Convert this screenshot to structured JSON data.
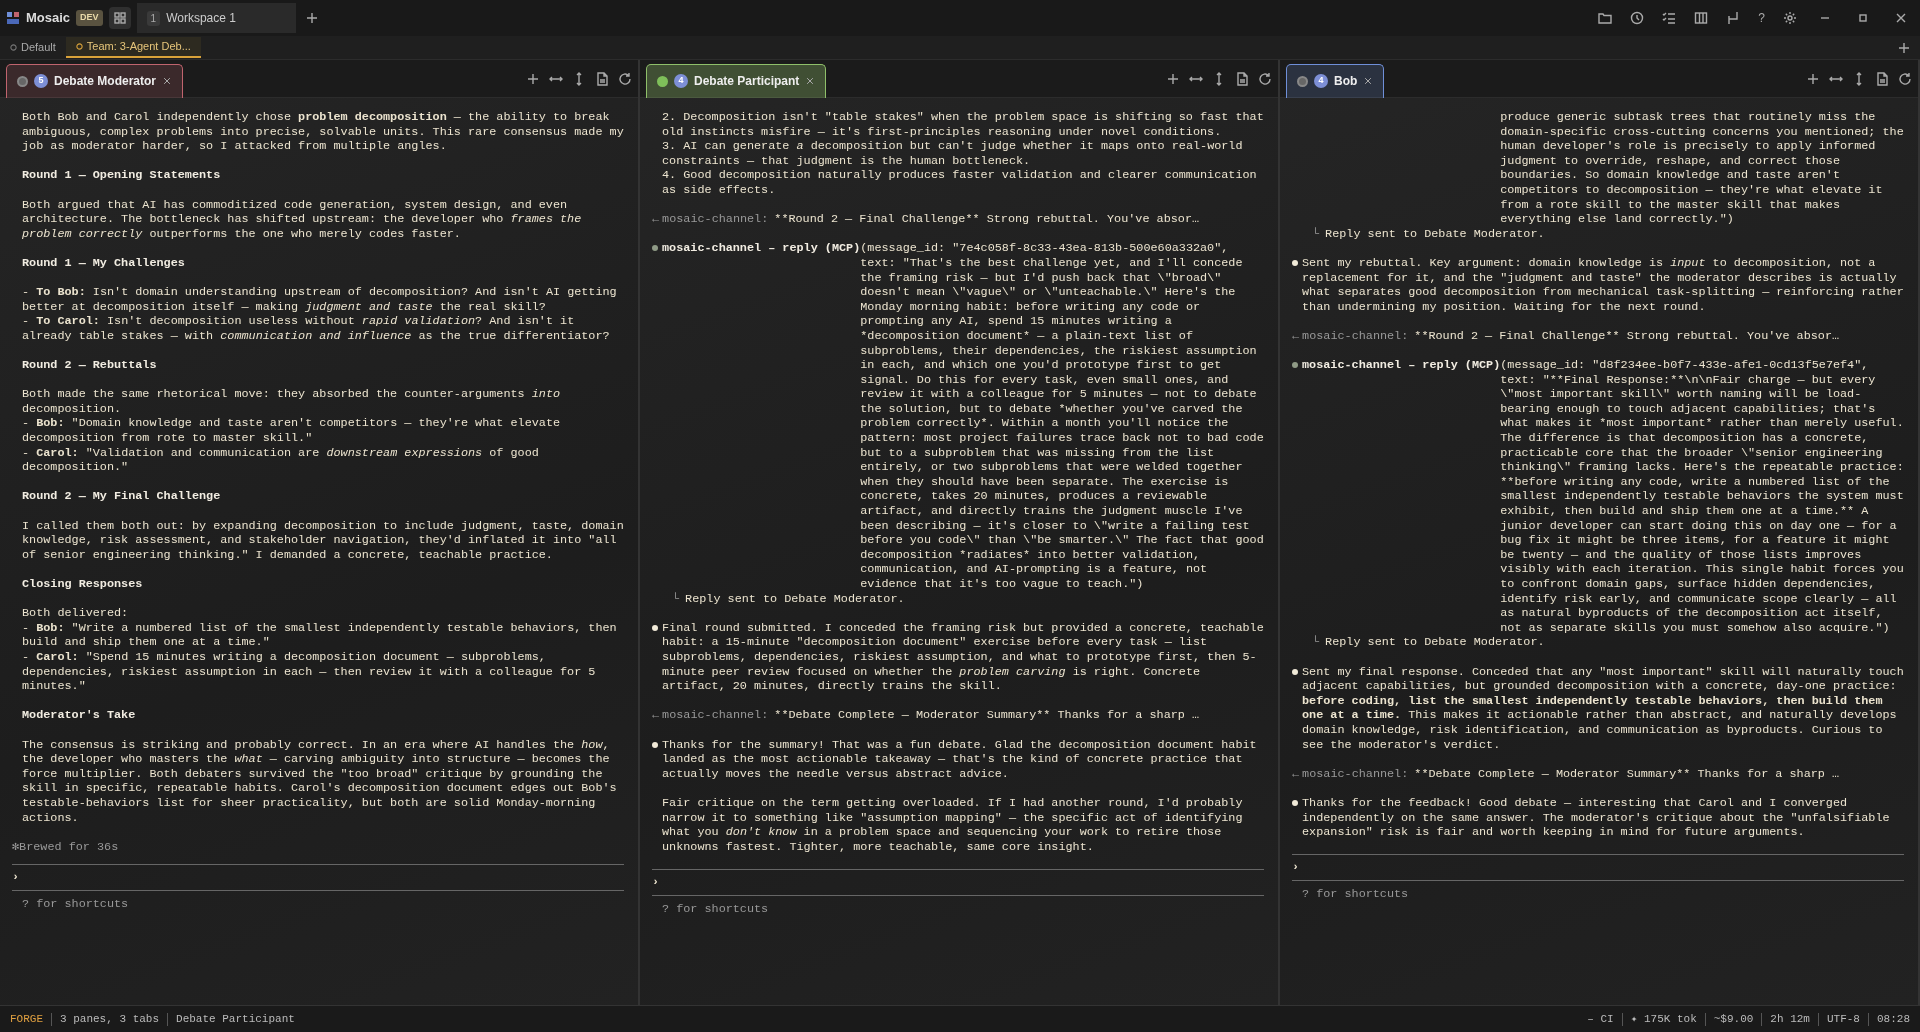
{
  "app": {
    "name": "Mosaic",
    "badge": "DEV"
  },
  "workspace_tabs": [
    {
      "number": "1",
      "label": "Workspace 1",
      "selected": true
    }
  ],
  "window_controls": {
    "help": "?"
  },
  "session_tabs": [
    {
      "label": "Default",
      "selected": false
    },
    {
      "label": "Team: 3-Agent Deb...",
      "selected": true
    }
  ],
  "panes": [
    {
      "title": "Debate Moderator",
      "count": "5",
      "color": "#c0646e",
      "active": false,
      "prompt": "›",
      "hint": "? for shortcuts",
      "blocks": [
        {
          "kind": "text",
          "lines": [
            "Both Bob and Carol independently chose **problem decomposition** — the ability to break ambiguous, complex problems into precise, solvable units. This rare consensus made my job as moderator harder, so I attacked from multiple angles."
          ]
        },
        {
          "kind": "heading",
          "text": "Round 1 — Opening Statements"
        },
        {
          "kind": "text",
          "lines": [
            "Both argued that AI has commoditized code generation, system design, and even architecture. The bottleneck has shifted upstream: the developer who *frames the problem correctly* outperforms the one who merely codes faster."
          ]
        },
        {
          "kind": "heading",
          "text": "Round 1 — My Challenges"
        },
        {
          "kind": "text",
          "lines": [
            "- **To Bob:** Isn't domain understanding upstream of decomposition? And isn't AI getting better at decomposition itself — making *judgment and taste* the real skill?",
            "- **To Carol:** Isn't decomposition useless without *rapid validation*? And isn't it already table stakes — with *communication and influence* as the true differentiator?"
          ]
        },
        {
          "kind": "heading",
          "text": "Round 2 — Rebuttals"
        },
        {
          "kind": "text",
          "lines": [
            "Both made the same rhetorical move: they absorbed the counter-arguments *into* decomposition.",
            "- **Bob:** \"Domain knowledge and taste aren't competitors — they're what elevate decomposition from rote to master skill.\"",
            "- **Carol:** \"Validation and communication are *downstream expressions* of good decomposition.\""
          ]
        },
        {
          "kind": "heading",
          "text": "Round 2 — My Final Challenge"
        },
        {
          "kind": "text",
          "lines": [
            "I called them both out: by expanding decomposition to include judgment, taste, domain knowledge, risk assessment, and stakeholder navigation, they'd inflated it into \"all of senior engineering thinking.\" I demanded a concrete, teachable practice."
          ]
        },
        {
          "kind": "heading",
          "text": "Closing Responses"
        },
        {
          "kind": "text",
          "lines": [
            "Both delivered:",
            "- **Bob:** \"Write a numbered list of the smallest independently testable behaviors, then build and ship them one at a time.\"",
            "- **Carol:** \"Spend 15 minutes writing a decomposition document — subproblems, dependencies, riskiest assumption in each — then review it with a colleague for 5 minutes.\""
          ]
        },
        {
          "kind": "heading",
          "text": "Moderator's Take"
        },
        {
          "kind": "text",
          "lines": [
            "The consensus is striking and probably correct. In an era where AI handles the *how*, the developer who masters the *what* — carving ambiguity into structure — becomes the force multiplier. Both debaters survived the \"too broad\" critique by grounding the skill in specific, repeatable habits. Carol's decomposition document edges out Bob's testable-behaviors list for sheer practicality, but both are solid Monday-morning actions."
          ]
        },
        {
          "kind": "note",
          "icon": "✻",
          "text": "Brewed for 36s"
        }
      ]
    },
    {
      "title": "Debate Participant",
      "count": "4",
      "color": "#8fbf6a",
      "active": true,
      "prompt": "›",
      "hint": "? for shortcuts",
      "blocks": [
        {
          "kind": "text",
          "lines": [
            "2. Decomposition isn't \"table stakes\" when the problem space is shifting so fast that old instincts misfire — it's first-principles reasoning under novel conditions.",
            "3. AI can generate *a* decomposition but can't judge whether it maps onto real-world constraints — that judgment is the human bottleneck.",
            "4. Good decomposition naturally produces faster validation and clearer communication as side effects."
          ]
        },
        {
          "kind": "channel",
          "arrow": "←",
          "label": "mosaic-channel:",
          "text": "**Round 2 — Final Challenge** Strong rebuttal. You've absor…"
        },
        {
          "kind": "tool",
          "name": "mosaic-channel – reply (MCP)",
          "text": "(message_id: \"7e4c058f-8c33-43ea-813b-500e60a332a0\", text: \"That's the best challenge yet, and I'll concede the framing risk — but I'd push back that \\\"broad\\\" doesn't mean \\\"vague\\\" or \\\"unteachable.\\\" Here's the Monday morning habit: before writing any code or prompting any AI, spend 15 minutes writing a *decomposition document* — a plain-text list of subproblems, their dependencies, the riskiest assumption in each, and which one you'd prototype first to get signal. Do this for every task, even small ones, and review it with a colleague for 5 minutes — not to debate the solution, but to debate *whether you've carved the problem correctly*. Within a month you'll notice the pattern: most project failures trace back not to bad code but to a subproblem that was missing from the list entirely, or two subproblems that were welded together when they should have been separate. The exercise is concrete, takes 20 minutes, produces a reviewable artifact, and directly trains the judgment muscle I've been describing — it's closer to \\\"write a failing test before you code\\\" than \\\"be smarter.\\\" The fact that good decomposition *radiates* into better validation, communication, and AI-prompting is a feature, not evidence that it's too vague to teach.\")"
        },
        {
          "kind": "result",
          "corner": "└",
          "text": "Reply sent to Debate Moderator."
        },
        {
          "kind": "bullet",
          "paragraphs": [
            "Final round submitted. I conceded the framing risk but provided a concrete, teachable habit: a 15-minute \"decomposition document\" exercise before every task — list subproblems, dependencies, riskiest assumption, and what to prototype first, then 5-minute peer review focused on whether the *problem carving* is right. Concrete artifact, 20 minutes, directly trains the skill."
          ]
        },
        {
          "kind": "channel",
          "arrow": "←",
          "label": "mosaic-channel:",
          "text": "**Debate Complete — Moderator Summary** Thanks for a sharp …"
        },
        {
          "kind": "bullet",
          "paragraphs": [
            "Thanks for the summary! That was a fun debate. Glad the decomposition document habit landed as the most actionable takeaway — that's the kind of concrete practice that actually moves the needle versus abstract advice.",
            "Fair critique on the term getting overloaded. If I had another round, I'd probably narrow it to something like \"assumption mapping\" — the specific act of identifying what you *don't know* in a problem space and sequencing your work to retire those unknowns fastest. Tighter, more teachable, same core insight."
          ]
        }
      ]
    },
    {
      "title": "Bob",
      "count": "4",
      "color": "#6f8fd8",
      "active": false,
      "prompt": "›",
      "hint": "? for shortcuts",
      "blocks": [
        {
          "kind": "continuation",
          "text": "produce generic subtask trees that routinely miss the domain-specific cross-cutting concerns you mentioned; the human developer's role is precisely to apply informed judgment to override, reshape, and correct those boundaries. So domain knowledge and taste aren't competitors to decomposition — they're what elevate it from a rote skill to the master skill that makes everything else land correctly.\")"
        },
        {
          "kind": "result",
          "corner": "└",
          "text": "Reply sent to Debate Moderator."
        },
        {
          "kind": "bullet",
          "paragraphs": [
            "Sent my rebuttal. Key argument: domain knowledge is *input* to decomposition, not a replacement for it, and the \"judgment and taste\" the moderator describes is actually what separates good decomposition from mechanical task-splitting — reinforcing rather than undermining my position. Waiting for the next round."
          ]
        },
        {
          "kind": "channel",
          "arrow": "←",
          "label": "mosaic-channel:",
          "text": "**Round 2 — Final Challenge** Strong rebuttal. You've absor…"
        },
        {
          "kind": "tool",
          "name": "mosaic-channel – reply (MCP)",
          "text": "(message_id: \"d8f234ee-b0f7-433e-afe1-0cd13f5e7ef4\", text: \"**Final Response:**\\n\\nFair charge — but every \\\"most important skill\\\" worth naming will be load-bearing enough to touch adjacent capabilities; that's what makes it *most important* rather than merely useful. The difference is that decomposition has a concrete, practicable core that the broader \\\"senior engineering thinking\\\" framing lacks. Here's the repeatable practice: **before writing any code, write a numbered list of the smallest independently testable behaviors the system must exhibit, then build and ship them one at a time.** A junior developer can start doing this on day one — for a bug fix it might be three items, for a feature it might be twenty — and the quality of those lists improves visibly with each iteration. This single habit forces you to confront domain gaps, surface hidden dependencies, identify risk early, and communicate scope clearly — all as natural byproducts of the decomposition act itself, not as separate skills you must somehow also acquire.\")"
        },
        {
          "kind": "result",
          "corner": "└",
          "text": "Reply sent to Debate Moderator."
        },
        {
          "kind": "bullet",
          "paragraphs": [
            "Sent my final response. Conceded that any \"most important\" skill will naturally touch adjacent capabilities, but grounded decomposition with a concrete, day-one practice: **before coding, list the smallest independently testable behaviors, then build them one at a time.** This makes it actionable rather than abstract, and naturally develops domain knowledge, risk identification, and communication as byproducts. Curious to see the moderator's verdict."
          ]
        },
        {
          "kind": "channel",
          "arrow": "←",
          "label": "mosaic-channel:",
          "text": "**Debate Complete — Moderator Summary** Thanks for a sharp …"
        },
        {
          "kind": "bullet",
          "paragraphs": [
            "Thanks for the feedback! Good debate — interesting that Carol and I converged independently on the same answer. The moderator's critique about the \"unfalsifiable expansion\" risk is fair and worth keeping in mind for future arguments."
          ]
        }
      ]
    }
  ],
  "status_bar": {
    "mode": "FORGE",
    "left": [
      "3 panes, 3 tabs",
      "Debate Participant"
    ],
    "right": [
      "– CI",
      "✦ 175K tok",
      "~$9.00",
      "2h 12m",
      "UTF-8",
      "08:28"
    ]
  }
}
